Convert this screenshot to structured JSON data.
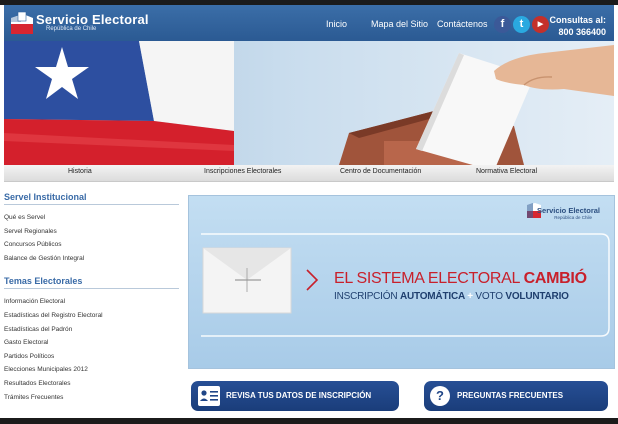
{
  "header": {
    "logo_title": "Servicio Electoral",
    "logo_subtitle": "República de Chile",
    "nav": [
      "Inicio",
      "Mapa del Sitio",
      "Contáctenos"
    ],
    "contact_label": "Consultas al:",
    "contact_phone": "800 366400"
  },
  "subnav": [
    "Historia",
    "Inscripciones Electorales",
    "Centro de Documentación",
    "Normativa Electoral"
  ],
  "sidebar": {
    "section1_title": "Servel Institucional",
    "section1_links": [
      "Qué es Servel",
      "Servel Regionales",
      "Concursos Públicos",
      "Balance de Gestión Integral"
    ],
    "section2_title": "Temas Electorales",
    "section2_links": [
      "Información Electoral",
      "Estadísticas del Registro Electoral",
      "Estadísticas del Padrón",
      "Gasto Electoral",
      "Partidos Políticos",
      "Elecciones Municipales 2012",
      "Resultados Electorales",
      "Trámites Frecuentes"
    ]
  },
  "promo": {
    "logo_title": "Servicio Electoral",
    "logo_subtitle": "República de Chile",
    "line1_a": "EL SISTEMA ELECTORAL ",
    "line1_b": "CAMBIÓ",
    "line2_a": "INSCRIPCIÓN ",
    "line2_b": "AUTOMÁTICA",
    "line2_plus": " + ",
    "line2_c": "VOTO ",
    "line2_d": "VOLUNTARIO"
  },
  "buttons": {
    "registration": "REVISA TUS DATOS DE INSCRIPCIÓN",
    "faq": "PREGUNTAS  FRECUENTES"
  },
  "colors": {
    "header_blue": "#2f619c",
    "accent_red": "#c8202b",
    "button_navy": "#1f4587",
    "sidebar_heading": "#3a6ba7"
  }
}
